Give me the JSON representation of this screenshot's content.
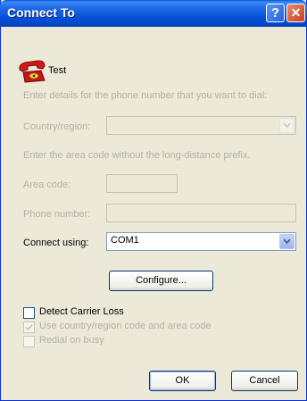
{
  "window": {
    "title": "Connect To",
    "help_glyph": "?",
    "close_glyph": "✕"
  },
  "connection": {
    "icon": "phone-icon",
    "name": "Test"
  },
  "instructions": {
    "phone": "Enter details for the phone number that you want to dial:",
    "area": "Enter the area code without the long-distance prefix."
  },
  "fields": {
    "country_label": "Country/region:",
    "country_value": "",
    "area_label": "Area code:",
    "area_value": "",
    "phone_label": "Phone number:",
    "phone_value": "",
    "connect_label": "Connect using:",
    "connect_value": "COM1"
  },
  "buttons": {
    "configure": "Configure...",
    "ok": "OK",
    "cancel": "Cancel"
  },
  "checkboxes": [
    {
      "label": "Detect Carrier Loss",
      "checked": false,
      "enabled": true
    },
    {
      "label": "Use country/region code and area code",
      "checked": true,
      "enabled": false
    },
    {
      "label": "Redial on busy",
      "checked": false,
      "enabled": false
    }
  ],
  "colors": {
    "titlebar": "#0650d9",
    "dialog_bg": "#ece9d8",
    "disabled_text": "#b3b0a6"
  }
}
